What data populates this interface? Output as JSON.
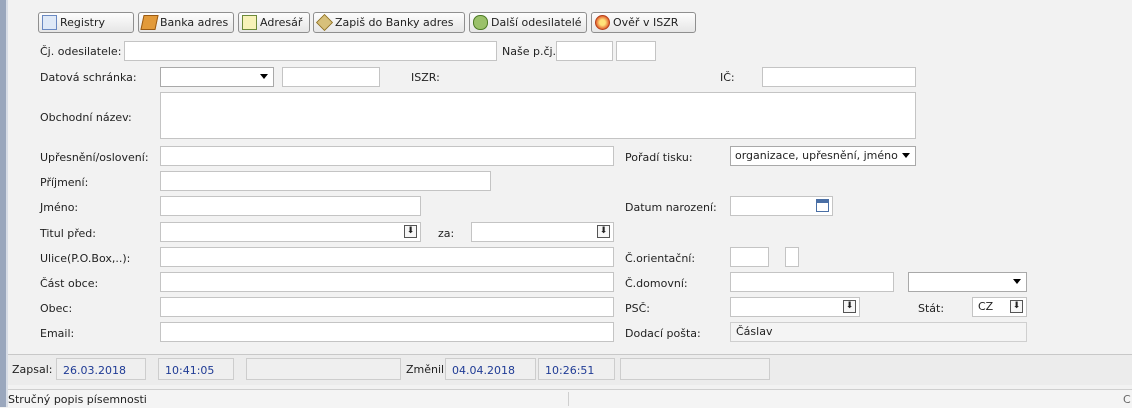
{
  "toolbar": {
    "registry": "Registry",
    "banka_adres": "Banka adres",
    "adresar": "Adresář",
    "zapis": "Zapiš do Banky adres",
    "dalsi": "Další odesilatelé",
    "over": "Ověř v ISZR"
  },
  "form": {
    "cj_odesilatele": "Čj. odesilatele:",
    "nase_pcj": "Naše p.čj.:",
    "datova_schranka": "Datová schránka:",
    "iszr": "ISZR:",
    "ic": "IČ:",
    "obchodni_nazev": "Obchodní název:",
    "upresneni": "Upřesnění/oslovení:",
    "poradi_tisku": "Pořadí tisku:",
    "poradi_tisku_value": "organizace, upřesnění, jméno",
    "prijmeni": "Příjmení:",
    "jmeno": "Jméno:",
    "datum_narozeni": "Datum narození:",
    "titul_pred": "Titul před:",
    "za": "za:",
    "ulice": "Ulice(P.O.Box,..):",
    "c_orientacni": "Č.orientační:",
    "cast_obce": "Část obce:",
    "c_domovni": "Č.domovní:",
    "obec": "Obec:",
    "psc": "PSČ:",
    "stat": "Stát:",
    "stat_value": "CZ",
    "email": "Email:",
    "dodaci_posta": "Dodací pošta:",
    "dodaci_posta_value": "Čáslav"
  },
  "footer": {
    "zapsal_label": "Zapsal:",
    "zapsal_date": "26.03.2018",
    "zapsal_time": "10:41:05",
    "zmenil_label": "Změnil:",
    "zmenil_date": "04.04.2018",
    "zmenil_time": "10:26:51"
  },
  "bottom": {
    "popis": "Stručný popis písemnosti",
    "right_char": "C"
  }
}
